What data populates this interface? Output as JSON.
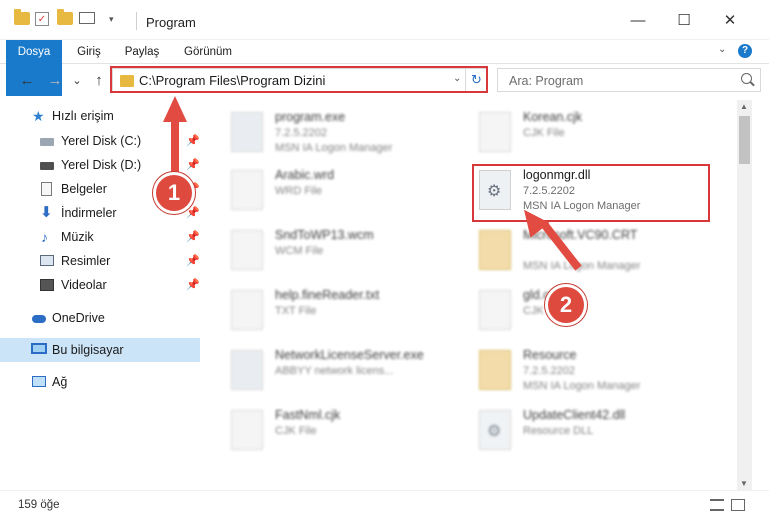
{
  "window": {
    "title": "Program",
    "minimize": "—",
    "maximize": "☐",
    "close": "✕"
  },
  "ribbon": {
    "tabs": [
      {
        "label": "Dosya"
      },
      {
        "label": "Giriş"
      },
      {
        "label": "Paylaş"
      },
      {
        "label": "Görünüm"
      }
    ],
    "help": "?"
  },
  "navigation": {
    "back": "←",
    "forward": "→",
    "recent": "⌄",
    "up": "↑",
    "address": "C:\\Program Files\\Program Dizini",
    "refresh": "↻",
    "search_placeholder": "Ara: Program"
  },
  "sidebar": {
    "items": [
      {
        "label": "Hızlı erişim",
        "icon": "star-icon"
      },
      {
        "label": "Yerel Disk (C:)",
        "icon": "drive-icon",
        "pinned": true
      },
      {
        "label": "Yerel Disk (D:)",
        "icon": "drive-icon",
        "pinned": true
      },
      {
        "label": "Belgeler",
        "icon": "documents-icon",
        "pinned": true
      },
      {
        "label": "İndirmeler",
        "icon": "downloads-icon",
        "pinned": true
      },
      {
        "label": "Müzik",
        "icon": "music-icon",
        "pinned": true
      },
      {
        "label": "Resimler",
        "icon": "pictures-icon",
        "pinned": true
      },
      {
        "label": "Videolar",
        "icon": "videos-icon",
        "pinned": true
      },
      {
        "label": "OneDrive",
        "icon": "onedrive-icon"
      },
      {
        "label": "Bu bilgisayar",
        "icon": "this-pc-icon",
        "selected": true
      },
      {
        "label": "Ağ",
        "icon": "network-icon"
      }
    ]
  },
  "files": [
    {
      "name": "program.exe",
      "line2": "7.2.5.2202",
      "line3": "MSN IA Logon Manager"
    },
    {
      "name": "Korean.cjk",
      "line2": "CJK File",
      "line3": ""
    },
    {
      "name": "Arabic.wrd",
      "line2": "WRD File",
      "line3": ""
    },
    {
      "name": "logonmgr.dll",
      "line2": "7.2.5.2202",
      "line3": "MSN IA Logon Manager"
    },
    {
      "name": "SndToWP13.wcm",
      "line2": "WCM File",
      "line3": ""
    },
    {
      "name": "Microsoft.VC90.CRT",
      "line2": "",
      "line3": "MSN IA Logon Manager"
    },
    {
      "name": "help.fineReader.txt",
      "line2": "TXT File",
      "line3": ""
    },
    {
      "name": "gld.cjk",
      "line2": "CJK File",
      "line3": ""
    },
    {
      "name": "NetworkLicenseServer.exe",
      "line2": "ABBYY network licens...",
      "line3": ""
    },
    {
      "name": "Resource",
      "line2": "7.2.5.2202",
      "line3": "MSN IA Logon Manager"
    },
    {
      "name": "FastNml.cjk",
      "line2": "CJK File",
      "line3": ""
    },
    {
      "name": "UpdateClient42.dll",
      "line2": "Resource DLL",
      "line3": ""
    }
  ],
  "status": {
    "item_count": "159 öğe"
  },
  "callouts": {
    "step1": "1",
    "step2": "2"
  },
  "colors": {
    "accent": "#1979ca",
    "highlight": "#d9383a",
    "selection": "#cce4f7"
  }
}
